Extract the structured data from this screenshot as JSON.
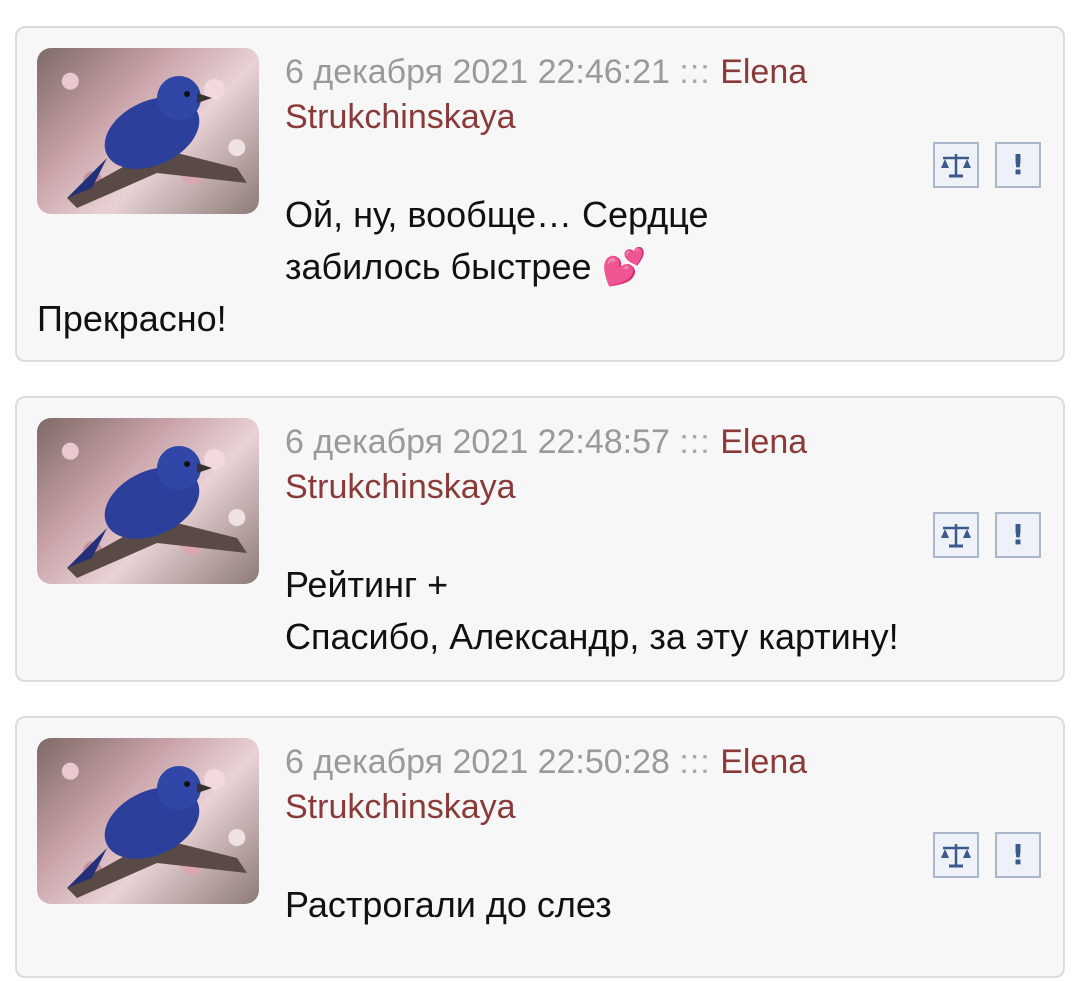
{
  "comments": [
    {
      "date": "6 декабря 2021 22:46:21",
      "separator": ":::",
      "author": "Elena Strukchinskaya",
      "text_lines": [
        "Ой, ну, вообще… Сердце",
        "забилось быстрее",
        "Прекрасно!"
      ],
      "emoji": "💕",
      "rate_icon": "scales-icon",
      "report_label": "!"
    },
    {
      "date": "6 декабря 2021 22:48:57",
      "separator": ":::",
      "author": "Elena Strukchinskaya",
      "text_lines": [
        "Рейтинг +",
        "Спасибо, Александр, за эту картину!"
      ],
      "rate_icon": "scales-icon",
      "report_label": "!"
    },
    {
      "date": "6 декабря 2021 22:50:28",
      "separator": ":::",
      "author": "Elena Strukchinskaya",
      "text_lines": [
        "Растрогали до слез"
      ],
      "rate_icon": "scales-icon",
      "report_label": "!"
    }
  ],
  "colors": {
    "author": "#8b3a3a",
    "meta": "#9a9a9a",
    "card_bg": "#f7f7f7",
    "card_border": "#dcdcdc",
    "button_border": "#a9b6cc",
    "button_icon": "#3b5a8c"
  }
}
